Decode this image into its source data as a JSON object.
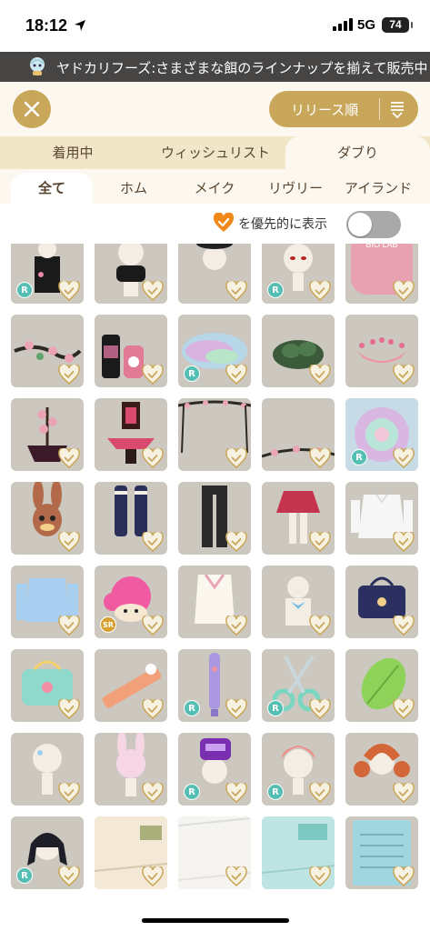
{
  "status_bar": {
    "time": "18:12",
    "network": "5G",
    "battery": "74"
  },
  "ticker": {
    "text": "ヤドカリフーズ:さまざまな餌のラインナップを揃えて販売中"
  },
  "header": {
    "sort_label": "リリース順"
  },
  "tabs": [
    {
      "label": "着用中"
    },
    {
      "label": "ウィッシュリスト"
    },
    {
      "label": "ダブり"
    }
  ],
  "subtabs": [
    {
      "label": "全て"
    },
    {
      "label": "ホム"
    },
    {
      "label": "メイク"
    },
    {
      "label": "リヴリー"
    },
    {
      "label": "アイランド"
    }
  ],
  "priority_toggle": {
    "label": "を優先的に表示",
    "on": false
  },
  "items": [
    {
      "name": "black-dress-outfit",
      "rarity": "R"
    },
    {
      "name": "white-figure-black-top",
      "rarity": ""
    },
    {
      "name": "witch-hat-figure",
      "rarity": ""
    },
    {
      "name": "red-eyes-makeup",
      "rarity": "R"
    },
    {
      "name": "bio-lab-sign",
      "rarity": ""
    },
    {
      "name": "cherry-blossom-branch",
      "rarity": ""
    },
    {
      "name": "potion-bottles",
      "rarity": ""
    },
    {
      "name": "pastel-smoke-effect",
      "rarity": "R"
    },
    {
      "name": "green-bush",
      "rarity": ""
    },
    {
      "name": "pink-crown",
      "rarity": ""
    },
    {
      "name": "blossom-ikebana-pot",
      "rarity": ""
    },
    {
      "name": "altar-basin",
      "rarity": ""
    },
    {
      "name": "hanging-blossom-vines",
      "rarity": ""
    },
    {
      "name": "ground-blossom-vines",
      "rarity": ""
    },
    {
      "name": "pastel-swirl-effect",
      "rarity": "R"
    },
    {
      "name": "bunny-hood-hat",
      "rarity": ""
    },
    {
      "name": "navy-knee-socks",
      "rarity": ""
    },
    {
      "name": "black-trousers",
      "rarity": ""
    },
    {
      "name": "red-pleated-skirt",
      "rarity": ""
    },
    {
      "name": "white-blouse",
      "rarity": ""
    },
    {
      "name": "blue-cardigan",
      "rarity": ""
    },
    {
      "name": "pink-hair-doll",
      "rarity": "SR"
    },
    {
      "name": "white-sweater-vest",
      "rarity": ""
    },
    {
      "name": "blue-bow-collar",
      "rarity": ""
    },
    {
      "name": "navy-school-bag",
      "rarity": ""
    },
    {
      "name": "mint-tote-bag",
      "rarity": ""
    },
    {
      "name": "bunny-ruler",
      "rarity": ""
    },
    {
      "name": "lavender-pen",
      "rarity": "R"
    },
    {
      "name": "mint-scissors",
      "rarity": "R"
    },
    {
      "name": "green-leaf-note",
      "rarity": ""
    },
    {
      "name": "bald-head-makeup",
      "rarity": ""
    },
    {
      "name": "pink-bunny-hat",
      "rarity": ""
    },
    {
      "name": "purple-gadget-hat",
      "rarity": "R"
    },
    {
      "name": "pink-short-hair",
      "rarity": "R"
    },
    {
      "name": "red-twin-tail-hair",
      "rarity": ""
    },
    {
      "name": "black-bob-hair",
      "rarity": "R"
    },
    {
      "name": "classroom-background",
      "rarity": ""
    },
    {
      "name": "white-room-background",
      "rarity": ""
    },
    {
      "name": "mint-classroom-background",
      "rarity": ""
    },
    {
      "name": "blue-notebook",
      "rarity": ""
    }
  ],
  "colors": {
    "accent": "#c9a75a",
    "tab_bg": "#f2e6c9",
    "card_bg": "#ccc8bf",
    "rarity_r": "#56bfb3",
    "rarity_sr": "#d6a030"
  }
}
